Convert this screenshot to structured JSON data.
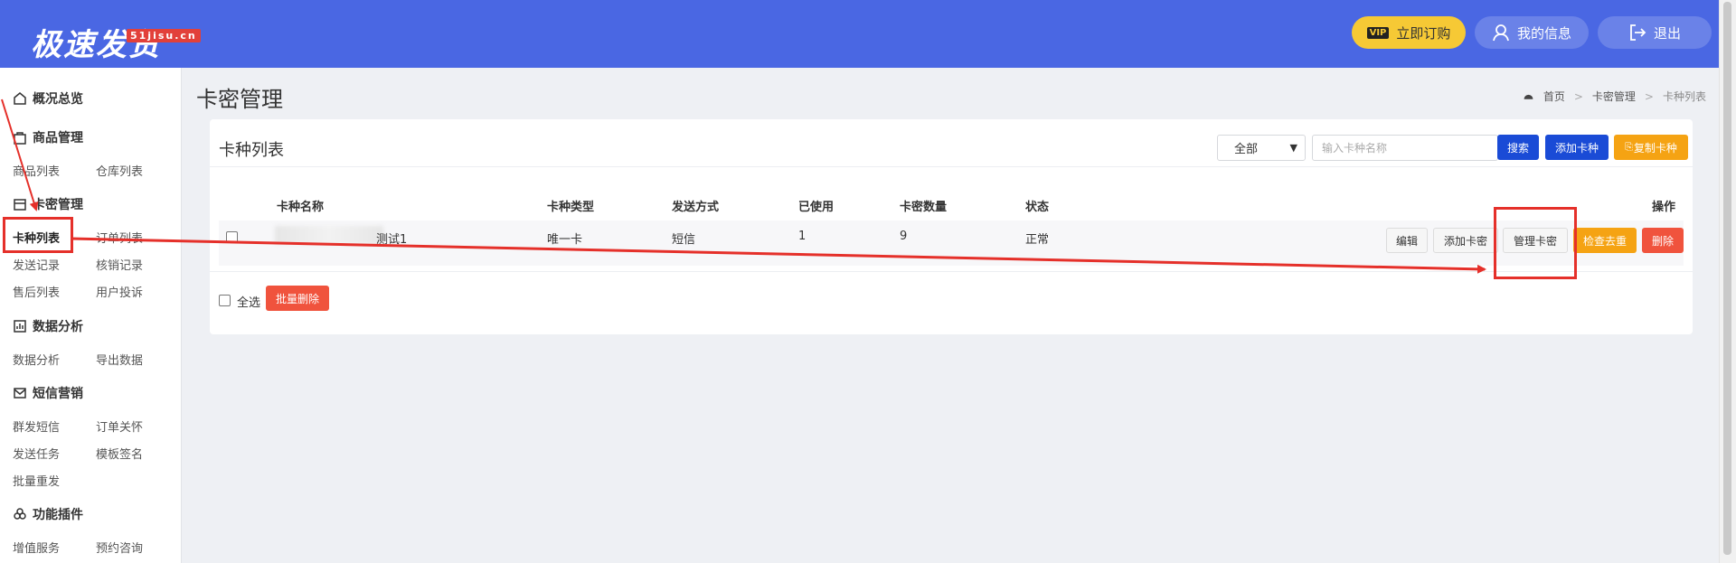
{
  "header": {
    "logo_text": "极速发货",
    "logo_badge": "51jisu.cn",
    "vip_tag": "VIP",
    "buy_label": "立即订购",
    "info_label": "我的信息",
    "logout_label": "退出"
  },
  "sidebar": {
    "overview": "概况总览",
    "goods": {
      "title": "商品管理",
      "items": [
        "商品列表",
        "仓库列表"
      ]
    },
    "cards": {
      "title": "卡密管理",
      "items": [
        "卡种列表",
        "订单列表",
        "发送记录",
        "核销记录",
        "售后列表",
        "用户投诉"
      ]
    },
    "analysis": {
      "title": "数据分析",
      "items": [
        "数据分析",
        "导出数据"
      ]
    },
    "sms": {
      "title": "短信营销",
      "items": [
        "群发短信",
        "订单关怀",
        "发送任务",
        "模板签名",
        "批量重发"
      ]
    },
    "plugins": {
      "title": "功能插件",
      "items": [
        "增值服务",
        "预约咨询"
      ]
    }
  },
  "main": {
    "page_title": "卡密管理",
    "breadcrumb": [
      "首页",
      "卡密管理",
      "卡种列表"
    ],
    "card_title": "卡种列表",
    "filter_selected": "全部",
    "search_placeholder": "输入卡种名称",
    "search_button": "搜索",
    "add_type_button": "添加卡种",
    "copy_type_button": "复制卡种",
    "columns": [
      "卡种名称",
      "卡种类型",
      "发送方式",
      "已使用",
      "卡密数量",
      "状态",
      "操作"
    ],
    "row": {
      "name_visible": "测试1",
      "type": "唯一卡",
      "send_method": "短信",
      "used": "1",
      "count": "9",
      "status": "正常",
      "actions": [
        "编辑",
        "添加卡密",
        "管理卡密",
        "检查去重",
        "删除"
      ]
    },
    "select_all": "全选",
    "batch_delete": "批量删除"
  },
  "colors": {
    "header_bg": "#4a67e3",
    "vip_bg": "#f6c935",
    "primary_blue": "#1a4bd6",
    "orange": "#f5a313",
    "red": "#f0533d",
    "annotation_red": "#e5302a"
  }
}
